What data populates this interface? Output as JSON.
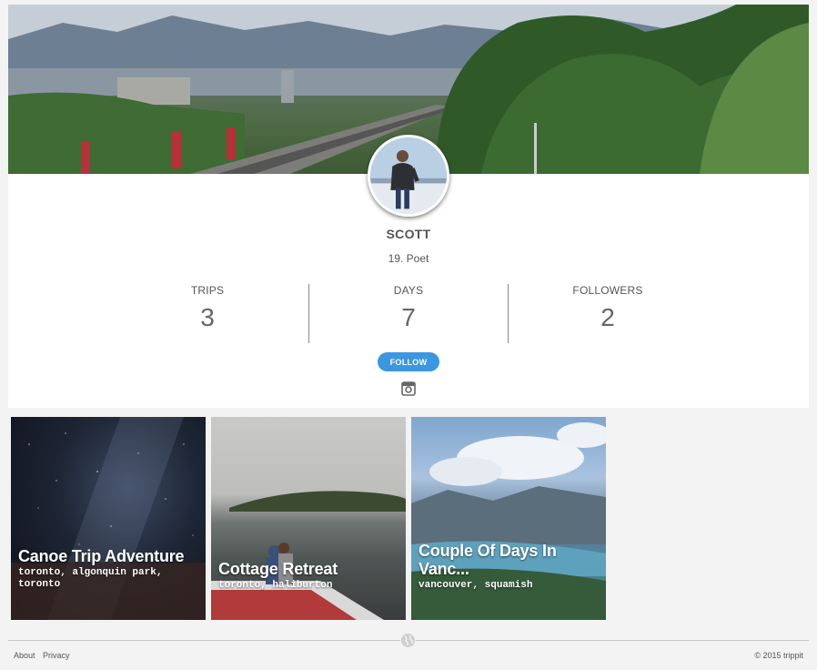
{
  "profile": {
    "name": "SCOTT",
    "bio": "19. Poet",
    "stats": [
      {
        "label": "TRIPS",
        "value": "3"
      },
      {
        "label": "DAYS",
        "value": "7"
      },
      {
        "label": "FOLLOWERS",
        "value": "2"
      }
    ],
    "follow_label": "FOLLOW",
    "social_icon": "instagram-icon"
  },
  "trips": [
    {
      "title": "Canoe Trip Adventure",
      "location": "toronto, algonquin park, toronto"
    },
    {
      "title": "Cottage Retreat",
      "location": "toronto, haliburton"
    },
    {
      "title": "Couple Of Days In Vanc...",
      "location": "vancouver, squamish"
    }
  ],
  "footer": {
    "links": [
      "About",
      "Privacy"
    ],
    "copyright": "© 2015 trippit",
    "icon": "globe-icon"
  },
  "colors": {
    "accent": "#3a97e0",
    "background": "#f3f3f3"
  }
}
